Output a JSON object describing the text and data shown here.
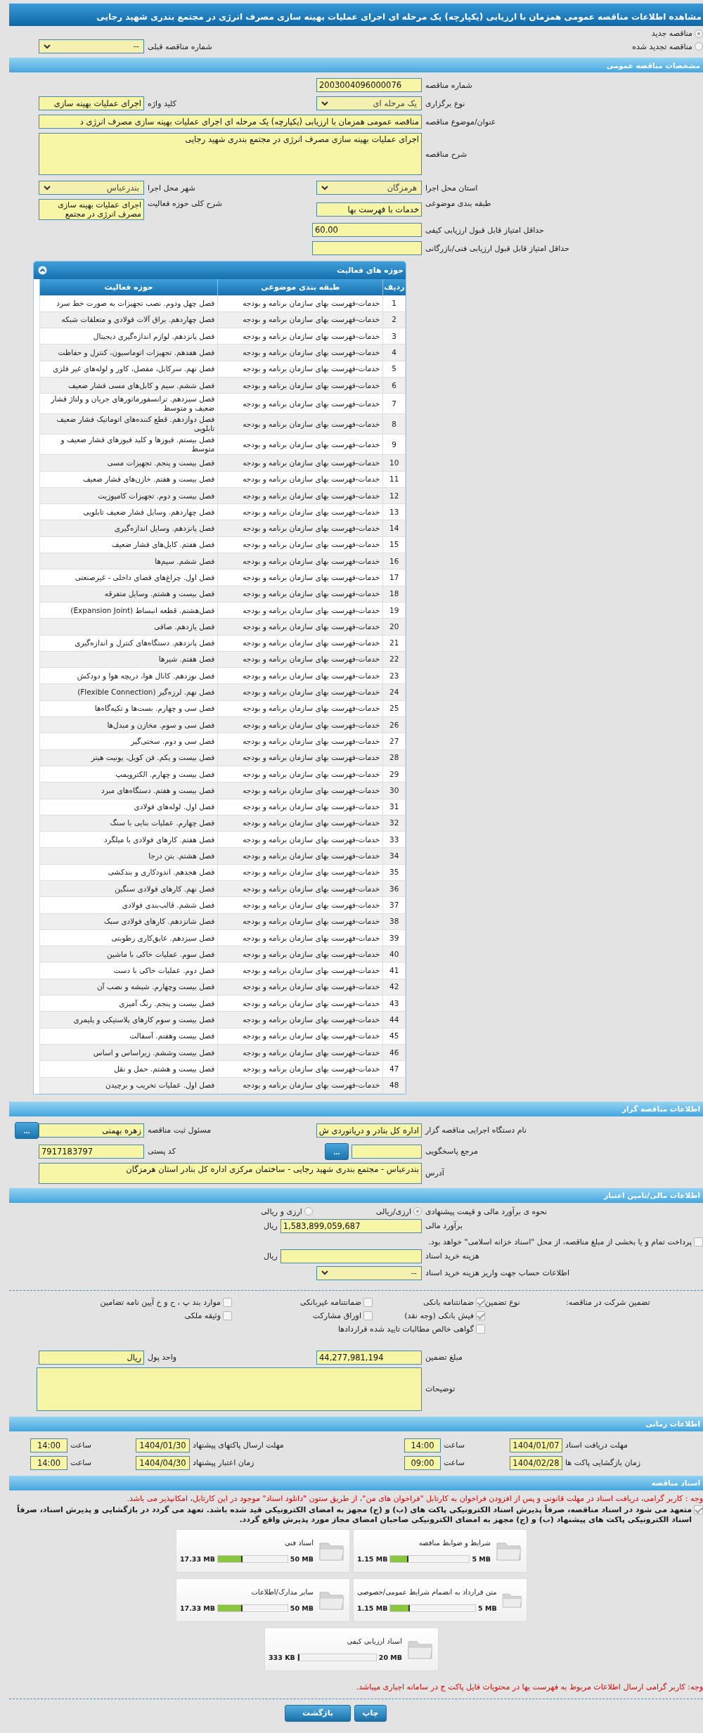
{
  "header": {
    "title": "مشاهده اطلاعات مناقصه عمومی همزمان با ارزیابی (یکپارچه) یک مرحله ای اجرای عملیات بهینه سازی مصرف انرژی در مجتمع بندری شهید رجایی"
  },
  "tender_status": [
    {
      "label": "مناقصه جدید",
      "selected": true
    },
    {
      "label": "مناقصه تجدید شده",
      "selected": false
    }
  ],
  "previous_tender": {
    "label": "شماره مناقصه قبلی",
    "value": "--"
  },
  "general": {
    "title": "مشخصات مناقصه عمومی",
    "tender_number": {
      "label": "شماره مناقصه",
      "value": "2003004096000076"
    },
    "holding_type": {
      "label": "نوع برگزاری",
      "value": "یک مرحله ای"
    },
    "keyword": {
      "label": "کلید واژه",
      "value": "اجرای عملیات بهینه سازی"
    },
    "subject": {
      "label": "عنوان/موضوع مناقصه",
      "value": "مناقصه عمومی همزمان با ارزیابی (یکپارچه) یک مرحله ای اجرای عملیات بهینه سازی مصرف انرژی د"
    },
    "description": {
      "label": "شرح مناقصه",
      "value": "اجرای عملیات بهینه سازی مصرف انرژی در مجتمع بندری شهید رجایی"
    },
    "province": {
      "label": "استان محل اجرا",
      "value": "هرمزگان"
    },
    "city": {
      "label": "شهر محل اجرا",
      "value": "بندرعباس"
    },
    "category": {
      "label": "طبقه بندی موضوعی",
      "value": "خدمات با فهرست بها"
    },
    "activity_summary": {
      "label": "شرح کلی حوزه فعالیت",
      "value": "اجرای عملیات بهینه سازی مصرف انرژی در مجتمع"
    },
    "min_quality_score": {
      "label": "حداقل امتیاز قابل قبول ارزیابی کیفی",
      "value": "60.00"
    },
    "min_technical_score": {
      "label": "حداقل امتیاز قابل قبول ارزیابی فنی/بازرگانی"
    }
  },
  "activity_scope": {
    "title": "حوزه های فعالیت",
    "expanded": true,
    "columns": [
      "ردیف",
      "طبقه بندی موضوعی",
      "حوزه فعالیت"
    ],
    "rows": [
      {
        "index": "1",
        "category": "خدمات-فهرست بهای سازمان برنامه و بودجه",
        "activity": "فصل چهل ودوم. نصب تجهیزات به صورت خط سرد"
      },
      {
        "index": "2",
        "category": "خدمات-فهرست بهای سازمان برنامه و بودجه",
        "activity": "فصل چهاردهم. یراق آلات فولادی و متعلقات شبکه"
      },
      {
        "index": "3",
        "category": "خدمات-فهرست بهای سازمان برنامه و بودجه",
        "activity": "فصل پانزدهم. لوازم اندازه‌گیری دیجیتال"
      },
      {
        "index": "4",
        "category": "خدمات-فهرست بهای سازمان برنامه و بودجه",
        "activity": "فصل هفدهم. تجهیزات اتوماسیون، کنترل و حفاظت"
      },
      {
        "index": "5",
        "category": "خدمات-فهرست بهای سازمان برنامه و بودجه",
        "activity": "فصل نهم. سرکابل، مفصل، کاور و لوله‌های غیر فلزی"
      },
      {
        "index": "6",
        "category": "خدمات-فهرست بهای سازمان برنامه و بودجه",
        "activity": "فصل ششم. سیم و کابل‌های مسی فشار ضعیف"
      },
      {
        "index": "7",
        "category": "خدمات-فهرست بهای سازمان برنامه و بودجه",
        "activity": "فصل سیزدهم. ترانسفورماتورهای جریان و ولتاژ فشار ضعیف و متوسط"
      },
      {
        "index": "8",
        "category": "خدمات-فهرست بهای سازمان برنامه و بودجه",
        "activity": "فصل دوازدهم. قطع کننده‌های اتوماتیک فشار ضعیف تابلویی"
      },
      {
        "index": "9",
        "category": "خدمات-فهرست بهای سازمان برنامه و بودجه",
        "activity": "فصل بیستم. فیوزها و کلید فیوزهای فشار ضعیف و متوسط"
      },
      {
        "index": "10",
        "category": "خدمات-فهرست بهای سازمان برنامه و بودجه",
        "activity": "فصل بیست و پنجم. تجهیزات مسی"
      },
      {
        "index": "11",
        "category": "خدمات-فهرست بهای سازمان برنامه و بودجه",
        "activity": "فصل بیست و هفتم. خازن‌های فشار ضعیف"
      },
      {
        "index": "12",
        "category": "خدمات-فهرست بهای سازمان برنامه و بودجه",
        "activity": "فصل بیست و دوم. تجهیزات کامپوزیت"
      },
      {
        "index": "13",
        "category": "خدمات-فهرست بهای سازمان برنامه و بودجه",
        "activity": "فصل چهاردهم. وسایل فشار ضعیف تابلویی"
      },
      {
        "index": "14",
        "category": "خدمات-فهرست بهای سازمان برنامه و بودجه",
        "activity": "فصل پانزدهم. وسایل اندازه‌گیری"
      },
      {
        "index": "15",
        "category": "خدمات-فهرست بهای سازمان برنامه و بودجه",
        "activity": "فصل هفتم. کابل‌های فشار ضعیف"
      },
      {
        "index": "16",
        "category": "خدمات-فهرست بهای سازمان برنامه و بودجه",
        "activity": "فصل ششم. سیم‌ها"
      },
      {
        "index": "17",
        "category": "خدمات-فهرست بهای سازمان برنامه و بودجه",
        "activity": "فصل اول. چراغ‌های فضای داخلی - غیرصنعتی"
      },
      {
        "index": "18",
        "category": "خدمات-فهرست بهای سازمان برنامه و بودجه",
        "activity": "فصل بیست و هشتم. وسایل متفرقه"
      },
      {
        "index": "19",
        "category": "خدمات-فهرست بهای سازمان برنامه و بودجه",
        "activity": "فصل‌هشتم. قطعه انبساط (Expansion Joint)"
      },
      {
        "index": "20",
        "category": "خدمات-فهرست بهای سازمان برنامه و بودجه",
        "activity": "فصل یازدهم. صافی"
      },
      {
        "index": "21",
        "category": "خدمات-فهرست بهای سازمان برنامه و بودجه",
        "activity": "فصل پانزدهم. دستگاه‌های کنترل و اندازه‌گیری"
      },
      {
        "index": "22",
        "category": "خدمات-فهرست بهای سازمان برنامه و بودجه",
        "activity": "فصل هفتم. شیرها"
      },
      {
        "index": "23",
        "category": "خدمات-فهرست بهای سازمان برنامه و بودجه",
        "activity": "فصل نوزدهم. کانال هوا، دریچه هوا و دودکش"
      },
      {
        "index": "24",
        "category": "خدمات-فهرست بهای سازمان برنامه و بودجه",
        "activity": "فصل نهم. لرزه‌گیر (Flexible Connection)"
      },
      {
        "index": "25",
        "category": "خدمات-فهرست بهای سازمان برنامه و بودجه",
        "activity": "فصل سی و چهارم. بست‌ها و تکیه‌گاه‌ها"
      },
      {
        "index": "26",
        "category": "خدمات-فهرست بهای سازمان برنامه و بودجه",
        "activity": "فصل سی و سوم. مخازن و مبدل‌ها"
      },
      {
        "index": "27",
        "category": "خدمات-فهرست بهای سازمان برنامه و بودجه",
        "activity": "فصل سی و دوم. سختی‌گیر"
      },
      {
        "index": "28",
        "category": "خدمات-فهرست بهای سازمان برنامه و بودجه",
        "activity": "فصل بیست و یکم. فن کویل، یونیت هیتر"
      },
      {
        "index": "29",
        "category": "خدمات-فهرست بهای سازمان برنامه و بودجه",
        "activity": "فصل بیست و چهارم. الکتروپمپ"
      },
      {
        "index": "30",
        "category": "خدمات-فهرست بهای سازمان برنامه و بودجه",
        "activity": "فصل بیست و هفتم. دستگاه‌های مبرد"
      },
      {
        "index": "31",
        "category": "خدمات-فهرست بهای سازمان برنامه و بودجه",
        "activity": "فصل اول. لوله‌های فولادی"
      },
      {
        "index": "32",
        "category": "خدمات-فهرست بهای سازمان برنامه و بودجه",
        "activity": "فصل چهارم. عملیات بنایی با سنگ"
      },
      {
        "index": "33",
        "category": "خدمات-فهرست بهای سازمان برنامه و بودجه",
        "activity": "فصل هفتم. کارهای فولادی با میلگرد"
      },
      {
        "index": "34",
        "category": "خدمات-فهرست بهای سازمان برنامه و بودجه",
        "activity": "فصل هشتم. بتن درجا"
      },
      {
        "index": "35",
        "category": "خدمات-فهرست بهای سازمان برنامه و بودجه",
        "activity": "فصل هجدهم. اندودکاری و بندکشی"
      },
      {
        "index": "36",
        "category": "خدمات-فهرست بهای سازمان برنامه و بودجه",
        "activity": "فصل نهم. کارهای فولادی سنگین"
      },
      {
        "index": "37",
        "category": "خدمات-فهرست بهای سازمان برنامه و بودجه",
        "activity": "فصل ششم. قالب‌بندی فولادی"
      },
      {
        "index": "38",
        "category": "خدمات-فهرست بهای سازمان برنامه و بودجه",
        "activity": "فصل شانزدهم. کارهای فولادی سبک"
      },
      {
        "index": "39",
        "category": "خدمات-فهرست بهای سازمان برنامه و بودجه",
        "activity": "فصل سیزدهم. عایق‌کاری رطوبتی"
      },
      {
        "index": "40",
        "category": "خدمات-فهرست بهای سازمان برنامه و بودجه",
        "activity": "فصل سوم. عملیات خاکی با ماشین"
      },
      {
        "index": "41",
        "category": "خدمات-فهرست بهای سازمان برنامه و بودجه",
        "activity": "فصل دوم. عملیات خاکی با دست"
      },
      {
        "index": "42",
        "category": "خدمات-فهرست بهای سازمان برنامه و بودجه",
        "activity": "فصل بیست وچهارم. شیشه و نصب آن"
      },
      {
        "index": "43",
        "category": "خدمات-فهرست بهای سازمان برنامه و بودجه",
        "activity": "فصل بیست و پنجم. رنگ آمیزی"
      },
      {
        "index": "44",
        "category": "خدمات-فهرست بهای سازمان برنامه و بودجه",
        "activity": "فصل بیست و سوم کارهای پلاستیکی و پلیمری"
      },
      {
        "index": "45",
        "category": "خدمات-فهرست بهای سازمان برنامه و بودجه",
        "activity": "فصل بیست وهفتم. آسفالت"
      },
      {
        "index": "46",
        "category": "خدمات-فهرست بهای سازمان برنامه و بودجه",
        "activity": "فصل بیست وششم. زیراساس و اساس"
      },
      {
        "index": "47",
        "category": "خدمات-فهرست بهای سازمان برنامه و بودجه",
        "activity": "فصل بیست و هشتم. حمل و نقل"
      },
      {
        "index": "48",
        "category": "خدمات-فهرست بهای سازمان برنامه و بودجه",
        "activity": "فصل اول. عملیات تخریب و برچیدن"
      }
    ]
  },
  "organizer": {
    "title": "اطلاعات مناقصه گزار",
    "org_name": {
      "label": "نام دستگاه اجرایی مناقصه گزار",
      "value": "اداره کل بنادر و دریانوردی ش"
    },
    "registrar": {
      "label": "مسئول ثبت مناقصه",
      "value": "زهره بهمنی",
      "button": "..."
    },
    "responder": {
      "label": "مرجع پاسخگویی",
      "button": "..."
    },
    "postal_code": {
      "label": "کد پستی",
      "value": "7917183797"
    },
    "address": {
      "label": "آدرس",
      "value": "بندرعباس - مجتمع بندری شهید رجایی - ساختمان مرکزی اداره کل بنادر استان هرمزگان"
    }
  },
  "finance": {
    "title": "اطلاعات مالی/تامین اعتبار",
    "method": {
      "label": "نحوه ی برآورد مالی و قیمت پیشنهادی",
      "options": [
        {
          "label": "ارزی/ریالی",
          "selected": true
        },
        {
          "label": "ارزی و ریالی",
          "selected": false
        }
      ]
    },
    "estimate": {
      "label": "برآورد مالی",
      "value": "1,583,899,059,687",
      "unit": "ریال"
    },
    "treasury": {
      "label": "پرداخت تمام و یا بخشی از مبلغ مناقصه، از محل \"اسناد خزانه اسلامی\" خواهد بود.",
      "checked": false
    },
    "document_cost": {
      "label": "هزینه خرید اسناد",
      "unit": "ریال"
    },
    "account": {
      "label": "اطلاعات حساب جهت واریز هزینه خرید اسناد",
      "value": "--"
    }
  },
  "guarantee": {
    "title": "تضمین شرکت در مناقصه:",
    "type_label": "نوع تضمین",
    "options": [
      {
        "label": "ضمانتنامه بانکی",
        "checked": true
      },
      {
        "label": "ضمانتنامه غیربانکی",
        "checked": false
      },
      {
        "label": "موارد بند پ ، ح و خ آیین نامه تضامین",
        "checked": false
      },
      {
        "label": "فیش بانکی (وجه نقد)",
        "checked": true
      },
      {
        "label": "اوراق مشارکت",
        "checked": false
      },
      {
        "label": "وثیقه ملکی",
        "checked": false
      },
      {
        "label": "گواهی خالص مطالبات تایید شده قراردادها",
        "checked": false
      }
    ],
    "amount": {
      "label": "مبلغ تضمین",
      "value": "44,277,981,194"
    },
    "currency": {
      "label": "واحد پول",
      "value": "ریال"
    },
    "notes": {
      "label": "توضیحات"
    }
  },
  "timing": {
    "title": "اطلاعات زمانی",
    "items": [
      {
        "label": "مهلت دریافت اسناد",
        "date": "1404/01/07",
        "time_label": "ساعت",
        "time": "14:00"
      },
      {
        "label": "مهلت ارسال پاکتهای پیشنهاد",
        "date": "1404/01/30",
        "time_label": "ساعت",
        "time": "14:00"
      },
      {
        "label": "زمان بازگشایی پاکت ها",
        "date": "1404/02/28",
        "time_label": "ساعت",
        "time": "09:00"
      },
      {
        "label": "زمان اعتبار پیشنهاد",
        "date": "1404/04/30",
        "time_label": "ساعت",
        "time": "14:00"
      }
    ]
  },
  "documents": {
    "title": "اسناد مناقصه",
    "notice": "وجه : کاربر گرامی، دریافت اسناد در مهلت قانونی و پس از افزودن فراخوان به کارتابل \"فراخوان های من\"، از طریق ستون \"دانلود اسناد\" موجود در این کارتابل، امکانپذیر می باشد.",
    "pledge": {
      "text": "متعهد می شود در اسناد مناقصه، صرفاً پذیرش اسناد الکترونیکی پاکت های (ب) و (ج) مجهز به امضای الکترونیکی قید شده باشد. تعهد می گردد در بازگشایی و پذیرش اسناد، صرفاً اسناد الکترونیکی پاکت های پیشنهاد (ب) و (ج) مجهز به امضای الکترونیکی صاحبان امضای مجاز مورد پذیرش واقع گردد.",
      "checked": true
    },
    "files": [
      {
        "name": "شرایط و ضوابط مناقصه",
        "used": "1.15 MB",
        "max": "5 MB",
        "level": 0.23
      },
      {
        "name": "اسناد فنی",
        "used": "17.33 MB",
        "max": "50 MB",
        "level": 0.35
      },
      {
        "name": "متن قرارداد به انضمام شرایط عمومی/خصوصی",
        "used": "1.15 MB",
        "max": "5 MB",
        "level": 0.23
      },
      {
        "name": "سایر مدارک/اطلاعات",
        "used": "17.33 MB",
        "max": "50 MB",
        "level": 0.35
      },
      {
        "name": "اسناد ارزیابی کیفی",
        "used": "333 KB",
        "max": "20 MB",
        "level": 0.016
      }
    ],
    "footer_notice": "وجه: کاربر گرامی ارسال اطلاعات مربوط به فهرست بها در محتویات فایل پاکت ج در سامانه اجباری میباشد."
  },
  "buttons": [
    "چاپ",
    "بازگشت"
  ]
}
